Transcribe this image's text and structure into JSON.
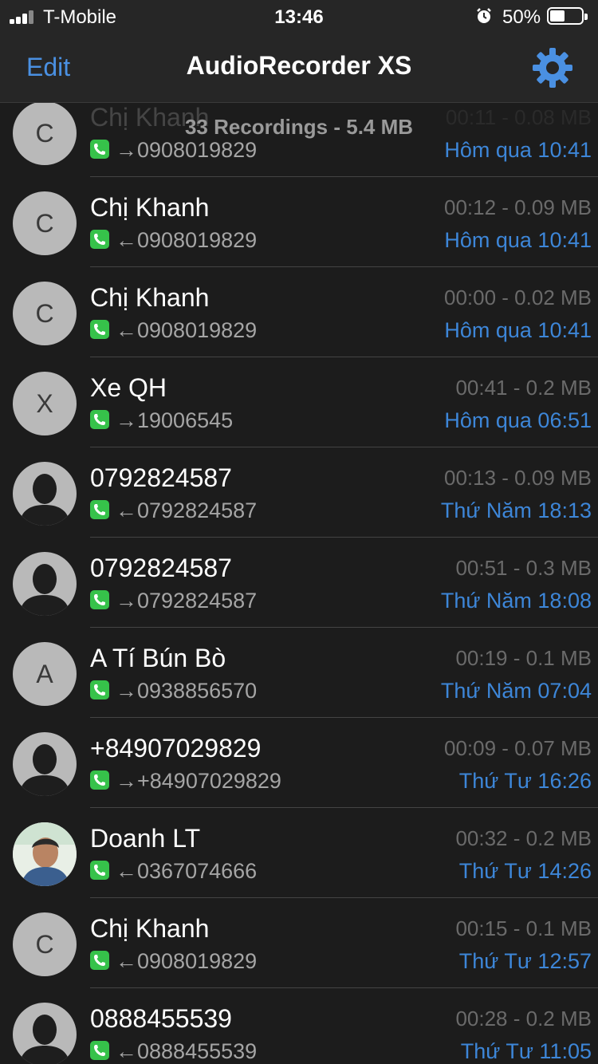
{
  "status_bar": {
    "carrier": "T-Mobile",
    "time": "13:46",
    "battery": "50%",
    "battery_level": 0.5
  },
  "nav": {
    "edit_label": "Edit",
    "title": "AudioRecorder XS",
    "settings_icon": "gear-icon"
  },
  "summary": "33 Recordings - 5.4 MB",
  "colors": {
    "accent": "#4a90e2",
    "date_blue": "#3d86d8",
    "call_green": "#36c24a",
    "background": "#1c1c1c"
  },
  "recordings": [
    {
      "name": "Chị Khanh",
      "avatar": "C",
      "direction": "→",
      "number": "0908019829",
      "meta": "00:11 - 0.08 MB",
      "when": "Hôm qua 10:41"
    },
    {
      "name": "Chị Khanh",
      "avatar": "C",
      "direction": "←",
      "number": "0908019829",
      "meta": "00:12 - 0.09 MB",
      "when": "Hôm qua 10:41"
    },
    {
      "name": "Chị Khanh",
      "avatar": "C",
      "direction": "←",
      "number": "0908019829",
      "meta": "00:00 - 0.02 MB",
      "when": "Hôm qua 10:41"
    },
    {
      "name": "Xe QH",
      "avatar": "X",
      "direction": "→",
      "number": "19006545",
      "meta": "00:41 - 0.2 MB",
      "when": "Hôm qua 06:51"
    },
    {
      "name": "0792824587",
      "avatar": "",
      "direction": "←",
      "number": "0792824587",
      "meta": "00:13 - 0.09 MB",
      "when": "Thứ Năm 18:13"
    },
    {
      "name": "0792824587",
      "avatar": "",
      "direction": "→",
      "number": "0792824587",
      "meta": "00:51 - 0.3 MB",
      "when": "Thứ Năm 18:08"
    },
    {
      "name": "A Tí Bún Bò",
      "avatar": "A",
      "direction": "→",
      "number": "0938856570",
      "meta": "00:19 - 0.1 MB",
      "when": "Thứ Năm 07:04"
    },
    {
      "name": "+84907029829",
      "avatar": "",
      "direction": "→",
      "number": "+84907029829",
      "meta": "00:09 - 0.07 MB",
      "when": "Thứ Tư 16:26"
    },
    {
      "name": "Doanh LT",
      "avatar": "photo",
      "direction": "←",
      "number": "0367074666",
      "meta": "00:32 - 0.2 MB",
      "when": "Thứ Tư 14:26"
    },
    {
      "name": "Chị Khanh",
      "avatar": "C",
      "direction": "←",
      "number": "0908019829",
      "meta": "00:15 - 0.1 MB",
      "when": "Thứ Tư 12:57"
    },
    {
      "name": "0888455539",
      "avatar": "",
      "direction": "←",
      "number": "0888455539",
      "meta": "00:28 - 0.2 MB",
      "when": "Thứ Tư 11:05"
    }
  ]
}
